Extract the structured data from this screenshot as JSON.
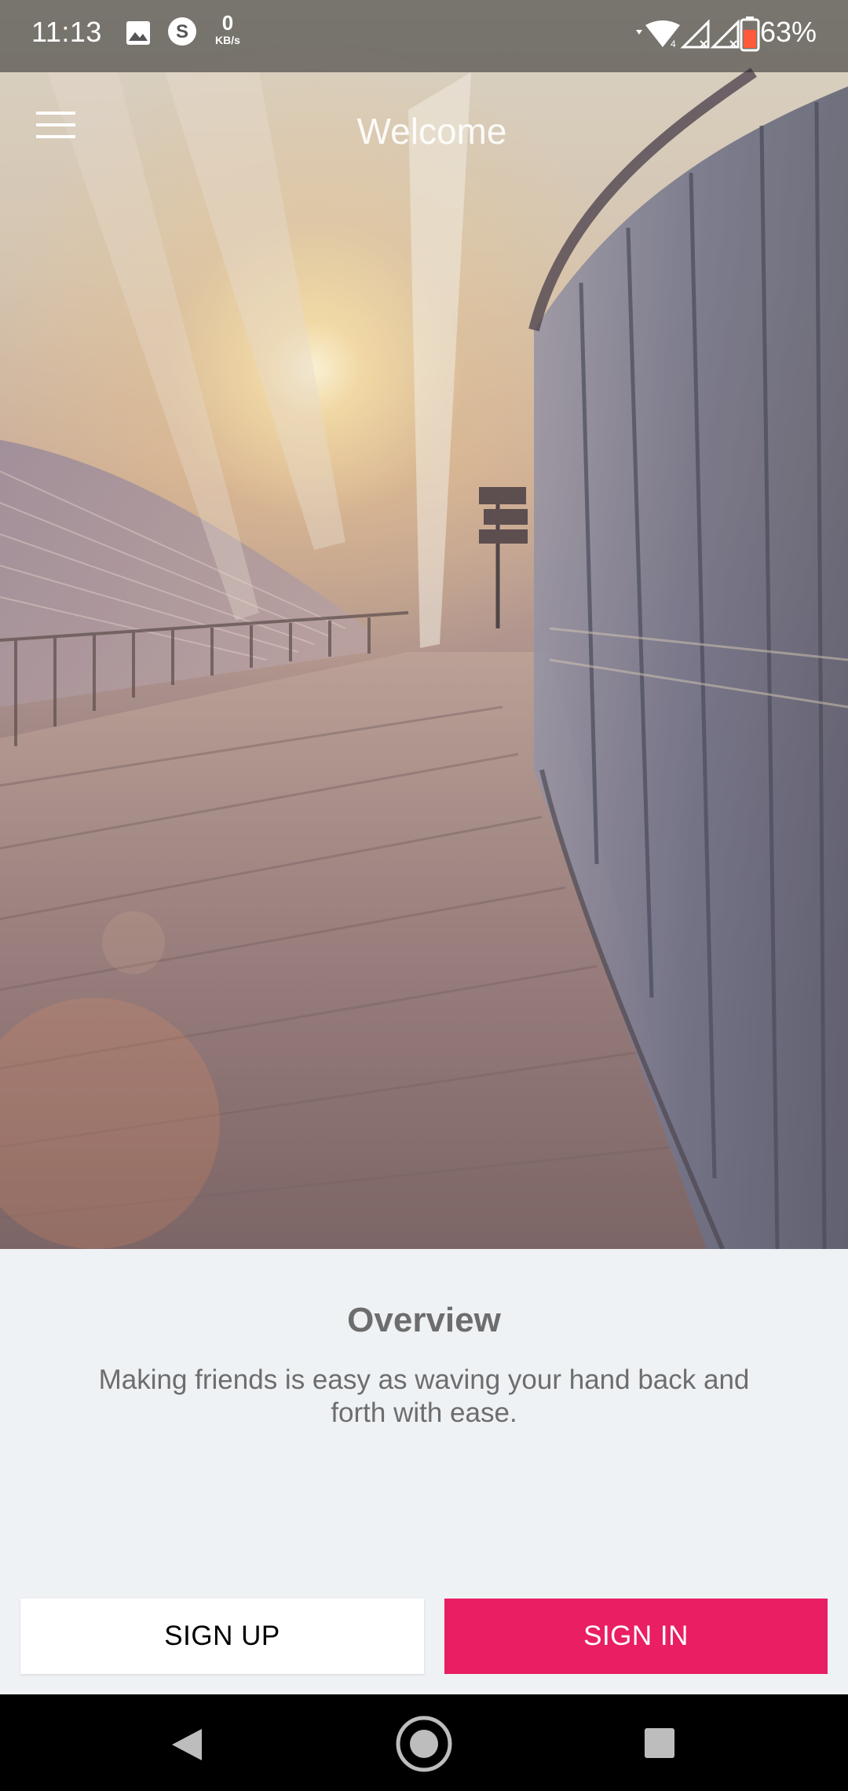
{
  "status_bar": {
    "time": "11:13",
    "netspeed_value": "0",
    "netspeed_unit": "KB/s",
    "battery_percent": "63%",
    "icons": [
      "gallery-notification-icon",
      "skype-icon",
      "wifi-icon",
      "signal-icon",
      "signal-icon",
      "battery-icon"
    ]
  },
  "app_bar": {
    "title": "Welcome",
    "menu_icon": "hamburger-menu-icon"
  },
  "content": {
    "title": "Overview",
    "body": "Making friends is easy as waving your hand back and forth with ease."
  },
  "actions": {
    "sign_up": "SIGN UP",
    "sign_in": "SIGN IN"
  },
  "nav_bar": {
    "icons": [
      "back-icon",
      "home-icon",
      "recents-icon"
    ]
  },
  "colors": {
    "accent": "#e91e63",
    "background": "#eff2f5",
    "text_muted": "#6d6d6d"
  }
}
